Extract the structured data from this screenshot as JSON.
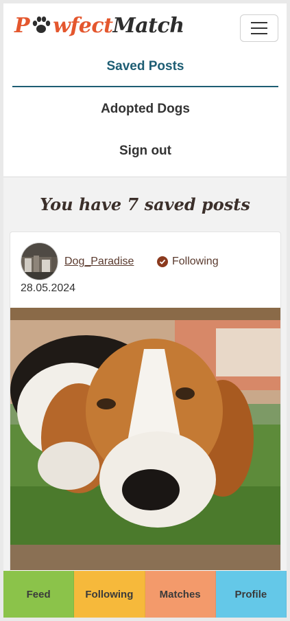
{
  "header": {
    "logo": {
      "part1": "P",
      "part2": "wfect",
      "part3": "Match"
    },
    "menu_icon": "hamburger-icon"
  },
  "nav": {
    "items": [
      {
        "label": "Saved Posts",
        "active": true
      },
      {
        "label": "Adopted Dogs",
        "active": false
      },
      {
        "label": "Sign out",
        "active": false
      }
    ]
  },
  "main": {
    "heading": "You have 7 saved posts"
  },
  "post": {
    "username": "Dog_Paradise",
    "follow_label": "Following",
    "date": "28.05.2024"
  },
  "bottom_nav": {
    "tabs": [
      {
        "label": "Feed",
        "color": "#8bc34a"
      },
      {
        "label": "Following",
        "color": "#f6b93b"
      },
      {
        "label": "Matches",
        "color": "#f39a6b"
      },
      {
        "label": "Profile",
        "color": "#64c8e8"
      }
    ]
  },
  "colors": {
    "brand": "#e4572e",
    "active_nav": "#1d5d73"
  }
}
